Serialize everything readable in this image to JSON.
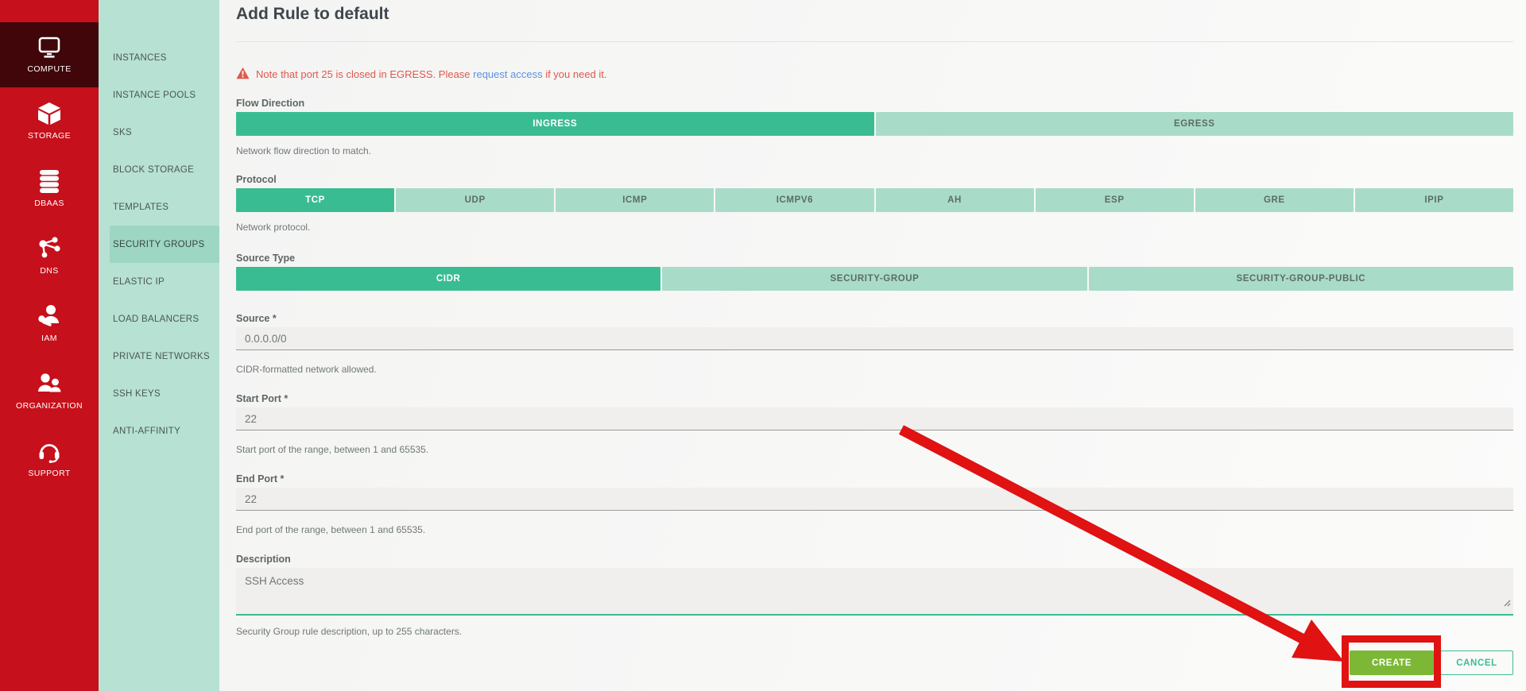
{
  "nav": {
    "items": [
      {
        "label": "COMPUTE",
        "icon": "monitor-icon",
        "active": true
      },
      {
        "label": "STORAGE",
        "icon": "cube-icon",
        "active": false
      },
      {
        "label": "DBAAS",
        "icon": "database-icon",
        "active": false
      },
      {
        "label": "DNS",
        "icon": "network-icon",
        "active": false
      },
      {
        "label": "IAM",
        "icon": "user-key-icon",
        "active": false
      },
      {
        "label": "ORGANIZATION",
        "icon": "users-icon",
        "active": false
      },
      {
        "label": "SUPPORT",
        "icon": "headset-icon",
        "active": false
      }
    ]
  },
  "subnav": {
    "items": [
      {
        "label": "INSTANCES",
        "active": false
      },
      {
        "label": "INSTANCE POOLS",
        "active": false
      },
      {
        "label": "SKS",
        "active": false
      },
      {
        "label": "BLOCK STORAGE",
        "active": false
      },
      {
        "label": "TEMPLATES",
        "active": false
      },
      {
        "label": "SECURITY GROUPS",
        "active": true
      },
      {
        "label": "ELASTIC IP",
        "active": false
      },
      {
        "label": "LOAD BALANCERS",
        "active": false
      },
      {
        "label": "PRIVATE NETWORKS",
        "active": false
      },
      {
        "label": "SSH KEYS",
        "active": false
      },
      {
        "label": "ANTI-AFFINITY",
        "active": false
      }
    ]
  },
  "page": {
    "title": "Add Rule to default",
    "warning": {
      "prefix": "Note that port 25 is closed in EGRESS. Please ",
      "link": "request access",
      "suffix": " if you need it."
    },
    "form": {
      "flow_direction": {
        "label": "Flow Direction",
        "options": [
          "INGRESS",
          "EGRESS"
        ],
        "selected": "INGRESS",
        "help": "Network flow direction to match."
      },
      "protocol": {
        "label": "Protocol",
        "options": [
          "TCP",
          "UDP",
          "ICMP",
          "ICMPV6",
          "AH",
          "ESP",
          "GRE",
          "IPIP"
        ],
        "selected": "TCP",
        "help": "Network protocol."
      },
      "source_type": {
        "label": "Source Type",
        "options": [
          "CIDR",
          "SECURITY-GROUP",
          "SECURITY-GROUP-PUBLIC"
        ],
        "selected": "CIDR"
      },
      "source": {
        "label": "Source *",
        "value": "0.0.0.0/0",
        "help": "CIDR-formatted network allowed."
      },
      "start_port": {
        "label": "Start Port *",
        "value": "22",
        "help": "Start port of the range, between 1 and 65535."
      },
      "end_port": {
        "label": "End Port *",
        "value": "22",
        "help": "End port of the range, between 1 and 65535."
      },
      "description": {
        "label": "Description",
        "value": "SSH Access",
        "help": "Security Group rule description, up to 255 characters."
      }
    },
    "actions": {
      "create": "CREATE",
      "cancel": "CANCEL"
    }
  },
  "colors": {
    "brand_red": "#c6101b",
    "nav_active_maroon": "#40060a",
    "mint_sidebar": "#b6e1d3",
    "accent_teal": "#3abc92",
    "segment_idle": "#a8dcc8",
    "create_green": "#7cb836",
    "cancel_teal": "#3cbd94",
    "warning_red": "#e0584c",
    "link_blue": "#5b93e4",
    "annotation_red": "#e01212"
  }
}
